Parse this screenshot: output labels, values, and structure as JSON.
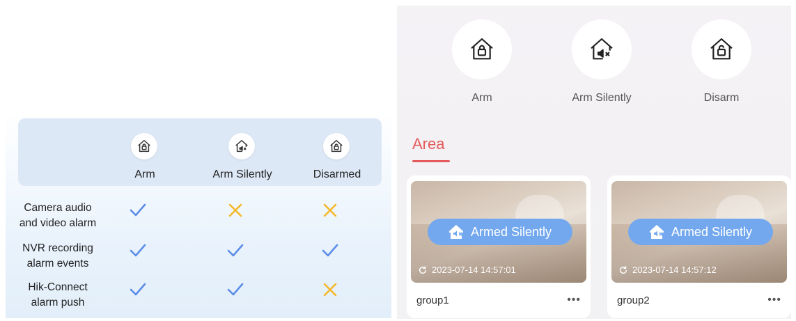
{
  "comparison": {
    "columns": [
      {
        "label": "Arm",
        "icon": "house-lock-icon"
      },
      {
        "label": "Arm Silently",
        "icon": "house-mute-icon"
      },
      {
        "label": "Disarmed",
        "icon": "house-unlock-icon"
      }
    ],
    "rows": [
      {
        "line1": "Camera audio",
        "line2": "and video alarm",
        "marks": [
          "check",
          "cross",
          "cross"
        ]
      },
      {
        "line1": "NVR recording",
        "line2": "alarm events",
        "marks": [
          "check",
          "check",
          "check"
        ]
      },
      {
        "line1": "Hik-Connect",
        "line2": "alarm push",
        "marks": [
          "check",
          "check",
          "cross"
        ]
      }
    ],
    "colors": {
      "check": "#5b8de8",
      "cross": "#f5b82a"
    }
  },
  "app": {
    "modes": [
      {
        "label": "Arm",
        "icon": "house-lock-icon"
      },
      {
        "label": "Arm Silently",
        "icon": "house-mute-icon"
      },
      {
        "label": "Disarm",
        "icon": "house-unlock-icon"
      }
    ],
    "tab": "Area",
    "accent": "#e45a5a",
    "cards": [
      {
        "status": "Armed Silently",
        "timestamp": "2023-07-14 14:57:01",
        "name": "group1",
        "more": "•••"
      },
      {
        "status": "Armed Silently",
        "timestamp": "2023-07-14 14:57:12",
        "name": "group2",
        "more": "•••"
      }
    ]
  }
}
